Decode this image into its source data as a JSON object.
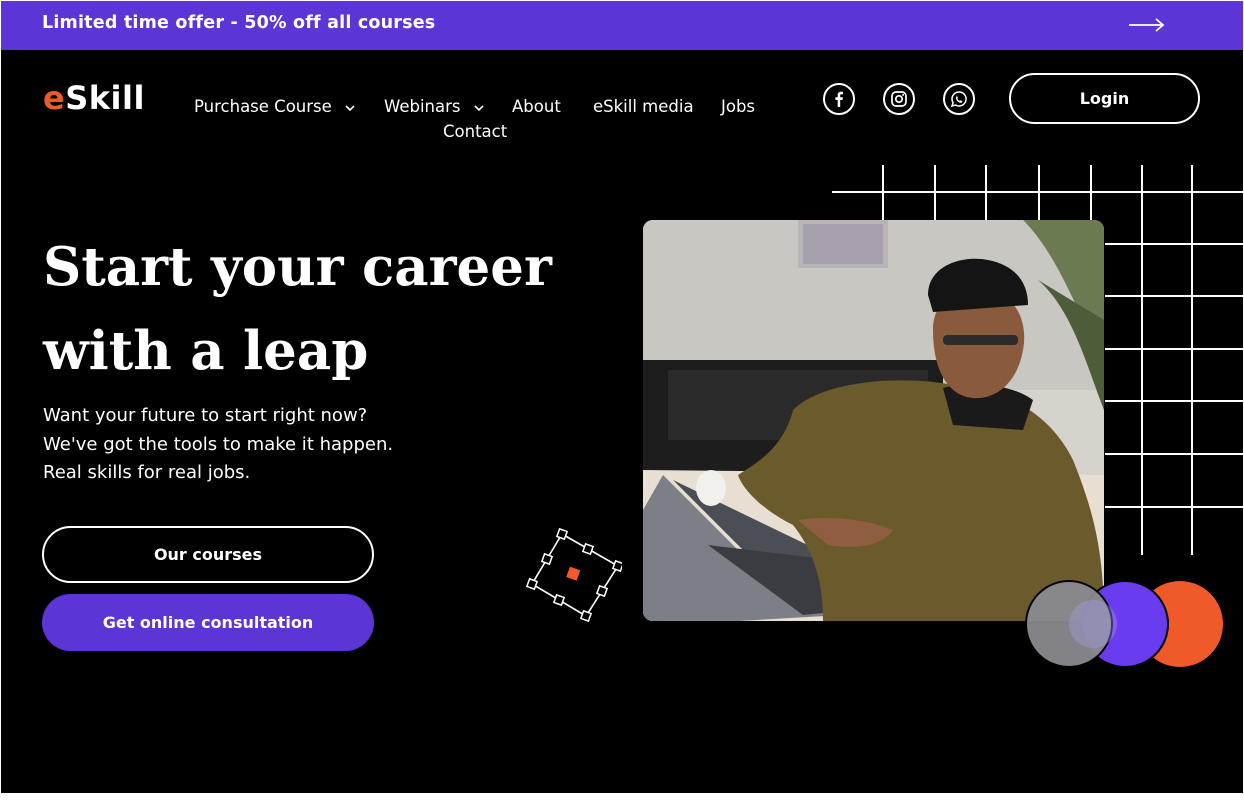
{
  "promo": {
    "text": "Limited time offer - 50% off all courses",
    "arrow_icon": "arrow-right-icon"
  },
  "header": {
    "logo_accent": "e",
    "logo_rest": "Skill",
    "nav": [
      {
        "label": "Purchase Course",
        "has_dropdown": true
      },
      {
        "label": "Webinars",
        "has_dropdown": true
      },
      {
        "label": "About",
        "has_dropdown": false
      },
      {
        "label": "eSkill media",
        "has_dropdown": false
      },
      {
        "label": "Jobs",
        "has_dropdown": false
      },
      {
        "label": "Contact",
        "has_dropdown": false
      }
    ],
    "social": [
      "facebook-icon",
      "instagram-icon",
      "whatsapp-icon"
    ],
    "login_label": "Login"
  },
  "hero": {
    "title_line1": "Start your career",
    "title_line2": "with a leap",
    "subtitle": "Want your future to start right now? We've got the tools to make it happen. Real skills for real jobs.",
    "primary_button": "Our courses",
    "secondary_button": "Get online consultation"
  },
  "colors": {
    "brand_purple": "#5b35d5",
    "accent_orange": "#f05a28",
    "background": "#000000",
    "text": "#ffffff"
  }
}
